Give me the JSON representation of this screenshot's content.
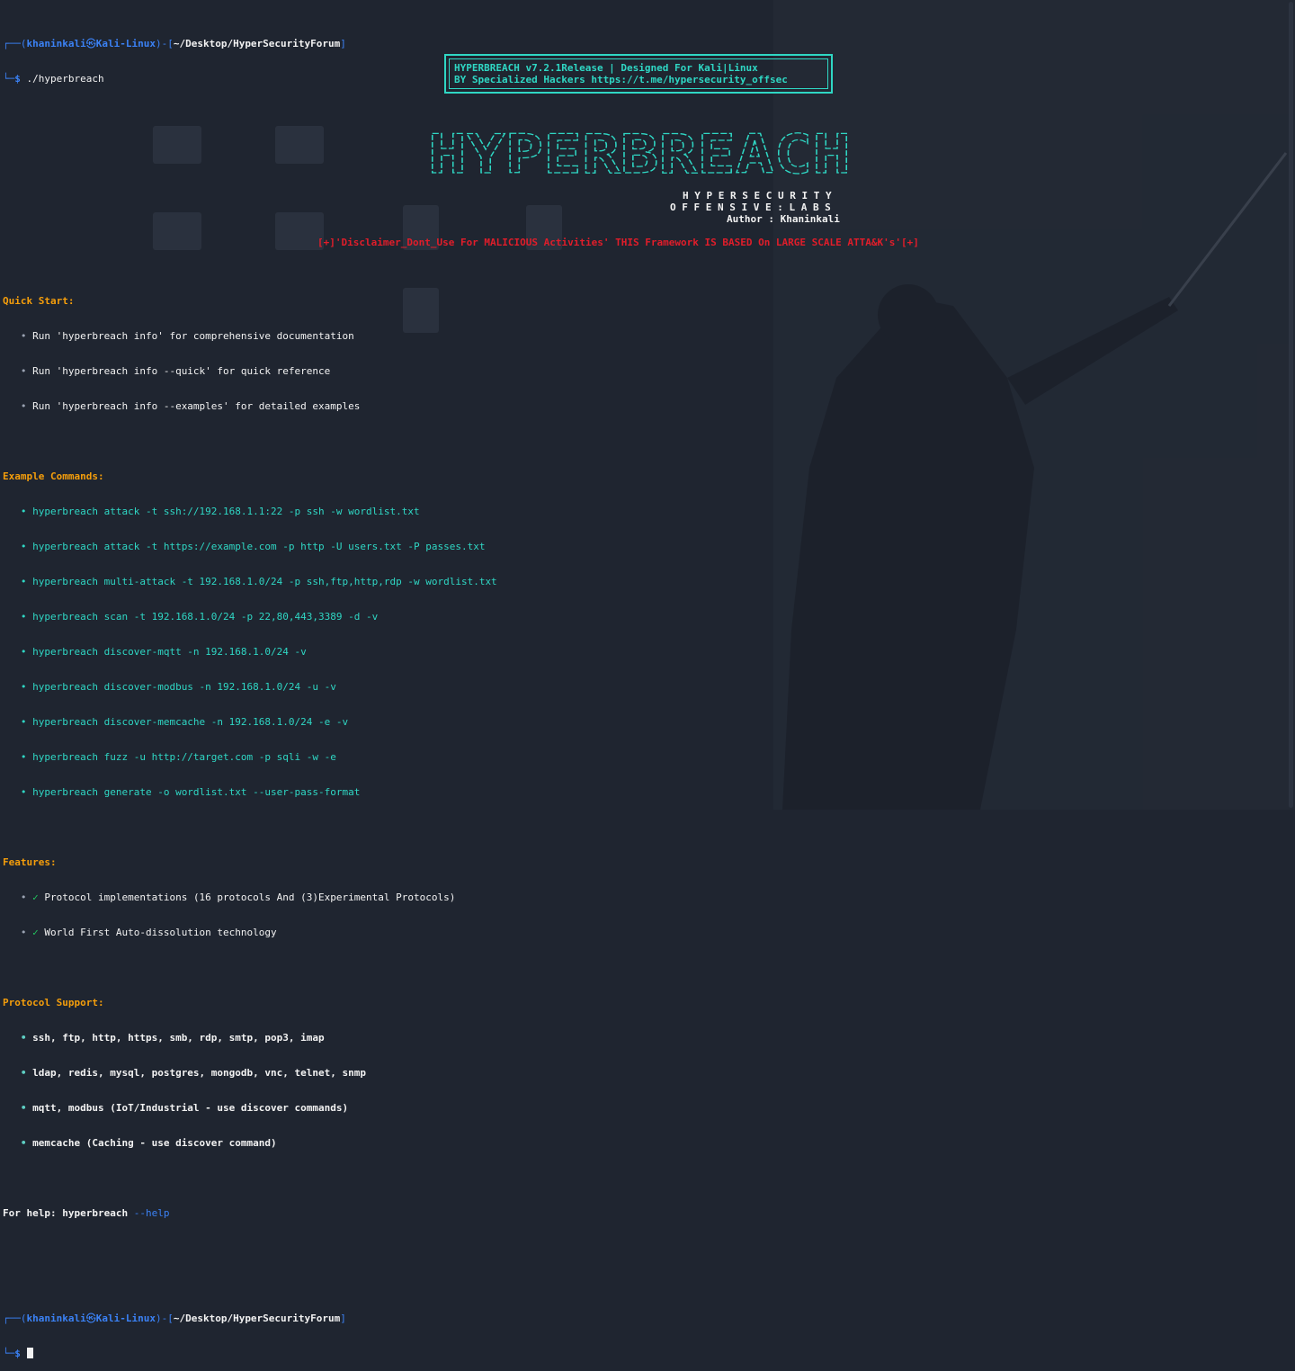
{
  "prompt": {
    "user": "khaninkali",
    "at": "㉿",
    "host": "Kali-Linux",
    "path": "~/Desktop/HyperSecurityForum",
    "symbol": "$",
    "command": "./hyperbreach"
  },
  "banner": {
    "line1": "HYPERBREACH v7.2.1Release | Designed For Kali|Linux",
    "line2": "BY Specialized Hackers https://t.me/hypersecurity_offsec"
  },
  "logo": {
    "text": "HYPERBREACH"
  },
  "labs": {
    "line1": "H Y P E R S E C U R I T Y",
    "line2": "O F F E N S I V E : L A B S",
    "author": "Author : Khaninkali"
  },
  "disclaimer": "[+]'Disclaimer_Dont_Use For MALICIOUS Activities' THIS Framework IS BASED On LARGE SCALE ATTA&K's'[+]",
  "quick_start": {
    "title": "Quick Start:",
    "items": [
      "Run 'hyperbreach info' for comprehensive documentation",
      "Run 'hyperbreach info --quick' for quick reference",
      "Run 'hyperbreach info --examples' for detailed examples"
    ]
  },
  "examples": {
    "title": "Example Commands:",
    "items": [
      "hyperbreach attack -t ssh://192.168.1.1:22 -p ssh -w wordlist.txt",
      "hyperbreach attack -t https://example.com -p http -U users.txt -P passes.txt",
      "hyperbreach multi-attack -t 192.168.1.0/24 -p ssh,ftp,http,rdp -w wordlist.txt",
      "hyperbreach scan -t 192.168.1.0/24 -p 22,80,443,3389 -d -v",
      "hyperbreach discover-mqtt -n 192.168.1.0/24 -v",
      "hyperbreach discover-modbus -n 192.168.1.0/24 -u -v",
      "hyperbreach discover-memcache -n 192.168.1.0/24 -e -v",
      "hyperbreach fuzz -u http://target.com -p sqli -w -e",
      "hyperbreach generate -o wordlist.txt --user-pass-format"
    ]
  },
  "features": {
    "title": "Features:",
    "check": "✓",
    "items": [
      "Protocol implementations (16 protocols And (3)Experimental Protocols)",
      "World First Auto-dissolution technology"
    ]
  },
  "protocols": {
    "title": "Protocol Support:",
    "items": [
      "ssh, ftp, http, https, smb, rdp, smtp, pop3, imap",
      "ldap, redis, mysql, postgres, mongodb, vnc, telnet, snmp",
      "mqtt, modbus (IoT/Industrial - use discover commands)",
      "memcache (Caching - use discover command)"
    ]
  },
  "help": {
    "prefix": "For help: ",
    "cmd": "hyperbreach",
    "flag": "--help"
  },
  "bullet": "•",
  "colors": {
    "background": "#1f2530",
    "prompt_blue": "#3b82f6",
    "banner_cyan": "#2fd7c4",
    "heading_orange": "#f59e0b",
    "disclaimer_red": "#e11d2a"
  }
}
